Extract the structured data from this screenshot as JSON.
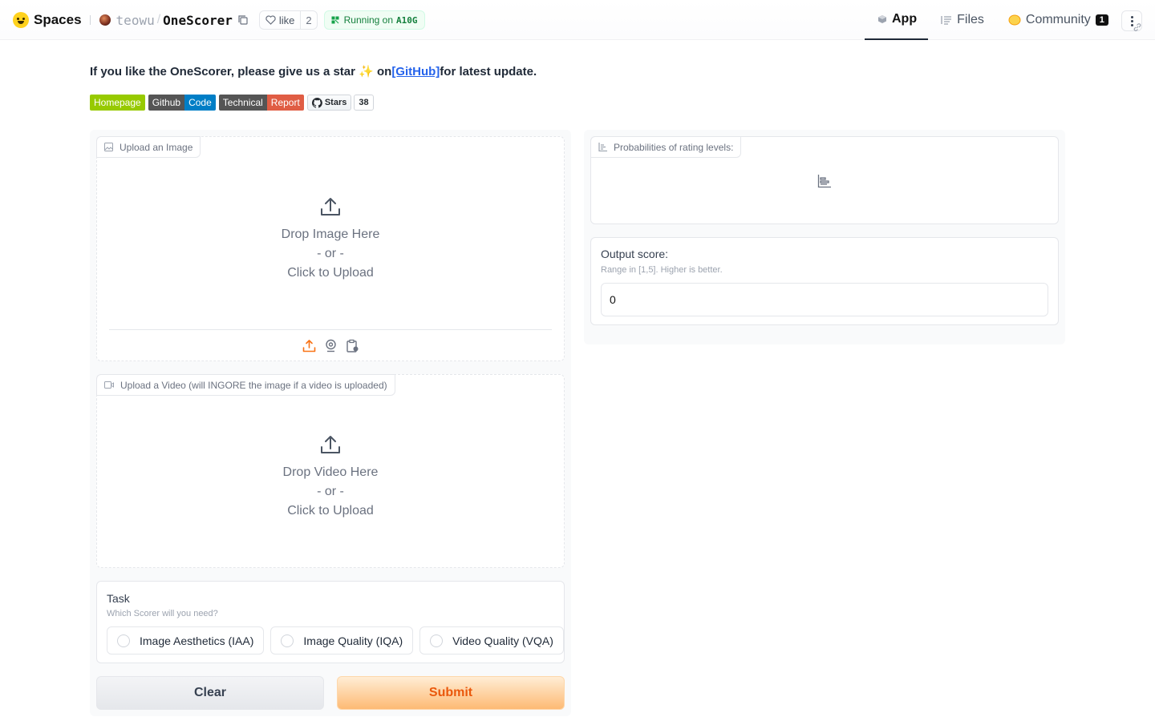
{
  "topbar": {
    "brand": "Spaces",
    "owner": "teowu",
    "repo": "OneScorer",
    "like_label": "like",
    "like_count": "2",
    "status_prefix": "Running on",
    "hardware": "A10G",
    "tabs": [
      {
        "label": "App",
        "icon": "cube-icon",
        "active": true
      },
      {
        "label": "Files",
        "icon": "files-icon",
        "active": false
      },
      {
        "label": "Community",
        "icon": "community-icon",
        "active": false,
        "badge": "1"
      }
    ]
  },
  "header": {
    "intro_before": "If you like the OneScorer, please give us a star ✨ on",
    "github_link": "[GitHub]",
    "intro_after": "for latest update.",
    "badges": [
      {
        "left": "Homepage",
        "left_color": "#97ca00"
      },
      {
        "left": "Github",
        "right": "Code",
        "left_color": "#555555",
        "right_color": "#007ec6"
      },
      {
        "left": "Technical",
        "right": "Report",
        "left_color": "#555555",
        "right_color": "#e05d44"
      }
    ],
    "stars_label": "Stars",
    "stars_count": "38"
  },
  "left": {
    "image_block": {
      "label": "Upload an Image",
      "drop": "Drop Image Here",
      "or": "- or -",
      "click": "Click to Upload"
    },
    "video_block": {
      "label": "Upload a Video (will INGORE the image if a video is uploaded)",
      "drop": "Drop Video Here",
      "or": "- or -",
      "click": "Click to Upload"
    },
    "task": {
      "label": "Task",
      "info": "Which Scorer will you need?",
      "options": [
        "Image Aesthetics (IAA)",
        "Image Quality (IQA)",
        "Video Quality (VQA)"
      ]
    },
    "clear_label": "Clear",
    "submit_label": "Submit"
  },
  "right": {
    "prob_label": "Probabilities of rating levels:",
    "output_label": "Output score:",
    "output_info": "Range in [1,5]. Higher is better.",
    "output_value": "0"
  },
  "colors": {
    "accent": "#ea580c",
    "running": "#15803d",
    "link": "#2563eb"
  }
}
